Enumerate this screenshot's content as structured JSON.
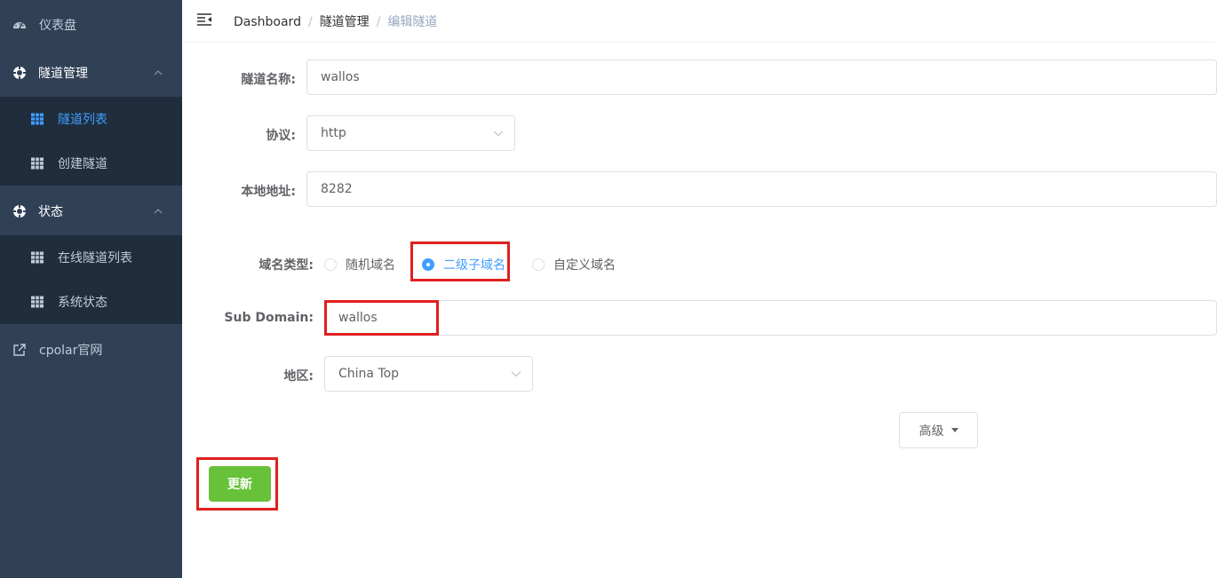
{
  "sidebar": {
    "dashboard": "仪表盘",
    "tunnel_mgmt": "隧道管理",
    "tunnel_list": "隧道列表",
    "create_tunnel": "创建隧道",
    "status": "状态",
    "online_tunnels": "在线隧道列表",
    "system_status": "系统状态",
    "cpolar_site": "cpolar官网"
  },
  "breadcrumb": {
    "home": "Dashboard",
    "section": "隧道管理",
    "current": "编辑隧道",
    "separator": "/"
  },
  "form": {
    "name_label": "隧道名称:",
    "name_value": "wallos",
    "protocol_label": "协议:",
    "protocol_value": "http",
    "local_label": "本地地址:",
    "local_value": "8282",
    "domain_type_label": "域名类型:",
    "domain_options": [
      "随机域名",
      "二级子域名",
      "自定义域名"
    ],
    "domain_selected": "二级子域名",
    "subdomain_label": "Sub Domain:",
    "subdomain_value": "wallos",
    "region_label": "地区:",
    "region_value": "China Top",
    "advanced_label": "高级",
    "update_label": "更新"
  },
  "colors": {
    "sidebar_bg": "#304156",
    "submenu_bg": "#1f2d3d",
    "active": "#409eff",
    "success": "#67c23a",
    "highlight": "#e02020"
  },
  "icons": {
    "dashboard": "gauge-icon",
    "tunnel_mgmt": "lifebuoy-icon",
    "submenu": "grid-table-icon",
    "status": "lifebuoy-icon",
    "external": "external-link-icon",
    "hamburger": "menu-fold-icon"
  }
}
